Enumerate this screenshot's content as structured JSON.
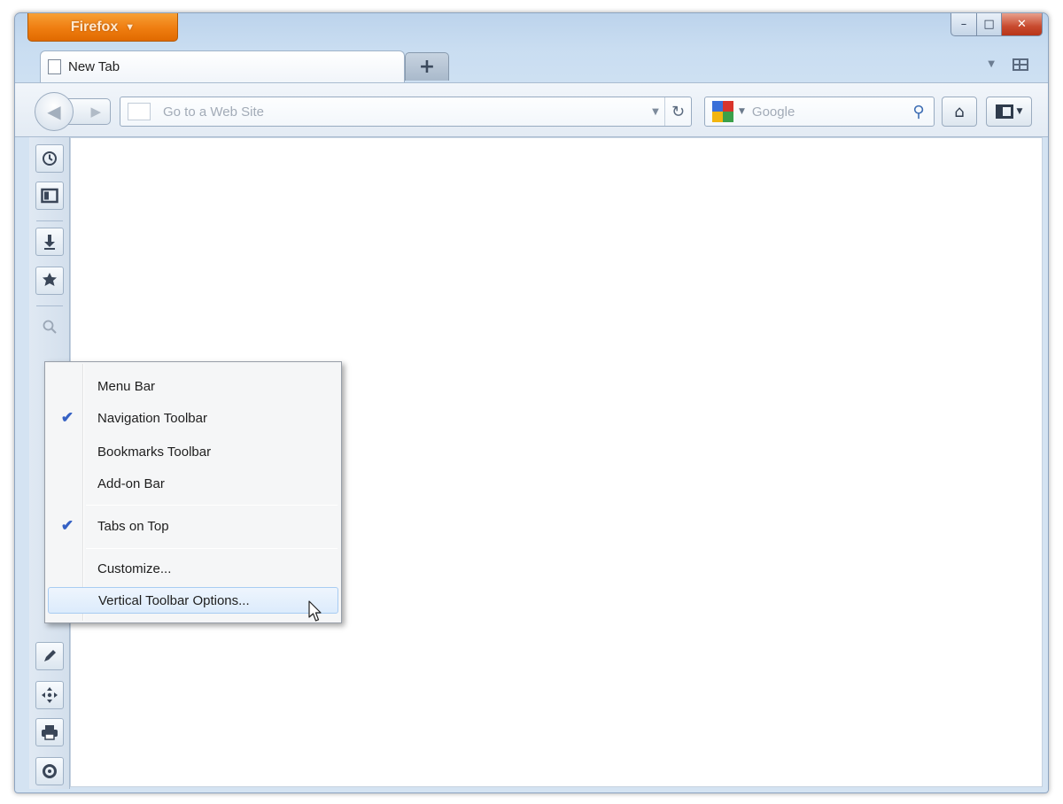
{
  "app_button": {
    "label": "Firefox",
    "caret": "▼"
  },
  "window_controls": {
    "minimize": "–",
    "maximize": "□",
    "close": "✕"
  },
  "tabs": [
    {
      "label": "New Tab"
    }
  ],
  "new_tab": {
    "label": "+"
  },
  "nav": {
    "url_placeholder": "Go to a Web Site",
    "search_placeholder": "Google",
    "back": "◀",
    "forward": "▶",
    "reload": "↻",
    "search_go": "⚲",
    "home": "⌂"
  },
  "vertical_toolbar": {
    "icons": [
      "clock-icon",
      "sidebar-icon",
      "download-icon",
      "addons-icon",
      "zoom-icon",
      "edit-icon",
      "move-icon",
      "print-icon",
      "sync-icon"
    ]
  },
  "context_menu": {
    "items": [
      {
        "label": "Menu Bar",
        "checked": false
      },
      {
        "label": "Navigation Toolbar",
        "checked": true
      },
      {
        "label": "Bookmarks Toolbar",
        "checked": false
      },
      {
        "label": "Add-on Bar",
        "checked": false
      },
      {
        "label": "Tabs on Top",
        "checked": true
      },
      {
        "label": "Customize...",
        "checked": false
      },
      {
        "label": "Vertical Toolbar Options...",
        "checked": false,
        "highlighted": true
      }
    ],
    "check_glyph": "✔"
  },
  "colors": {
    "accent_orange": "#ef7d10",
    "frame_blue": "#c9ddf1",
    "check_blue": "#3561c4"
  }
}
